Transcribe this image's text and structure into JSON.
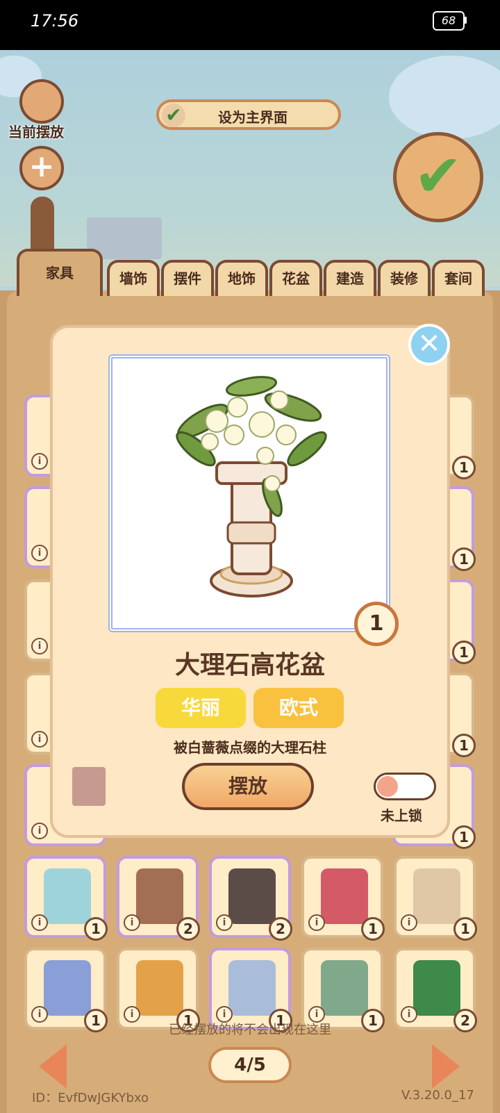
{
  "status_bar": {
    "time": "17:56",
    "battery": "68"
  },
  "toolbar": {
    "placed_label": "当前摆放",
    "add_label": "+",
    "set_main_label": "设为主界面"
  },
  "tabs": [
    {
      "label": "家具"
    },
    {
      "label": "墙饰"
    },
    {
      "label": "摆件"
    },
    {
      "label": "地饰"
    },
    {
      "label": "花盆"
    },
    {
      "label": "建造"
    },
    {
      "label": "装修"
    },
    {
      "label": "套间"
    }
  ],
  "modal": {
    "item_name": "大理石高花盆",
    "count": "1",
    "tags": [
      "华丽",
      "欧式"
    ],
    "description": "被白蔷薇点缀的大理石柱",
    "place_button": "摆放",
    "lock_label": "未上锁"
  },
  "grid_row_1": [
    {
      "count": "1",
      "info": "i",
      "color": "#9fd3dc"
    },
    {
      "count": "2",
      "info": "i",
      "color": "#a26f52"
    },
    {
      "count": "2",
      "info": "i",
      "color": "#5b4c48"
    },
    {
      "count": "1",
      "info": "i",
      "color": "#d45a68"
    },
    {
      "count": "1",
      "info": "i",
      "color": "#e0c7a6"
    }
  ],
  "grid_row_2": [
    {
      "count": "1",
      "info": "i",
      "color": "#8a9fd8"
    },
    {
      "count": "1",
      "info": "i",
      "color": "#e3a24a"
    },
    {
      "count": "1",
      "info": "i",
      "color": "#a9bddb"
    },
    {
      "count": "1",
      "info": "i",
      "color": "#7fa98a"
    },
    {
      "count": "2",
      "info": "i",
      "color": "#3d8a4a"
    }
  ],
  "footer": {
    "hint": "已经摆放的将不会出现在这里",
    "page": "4/5",
    "user_id": "ID：EvfDwJGKYbxo",
    "version": "V.3.20.0_17"
  }
}
